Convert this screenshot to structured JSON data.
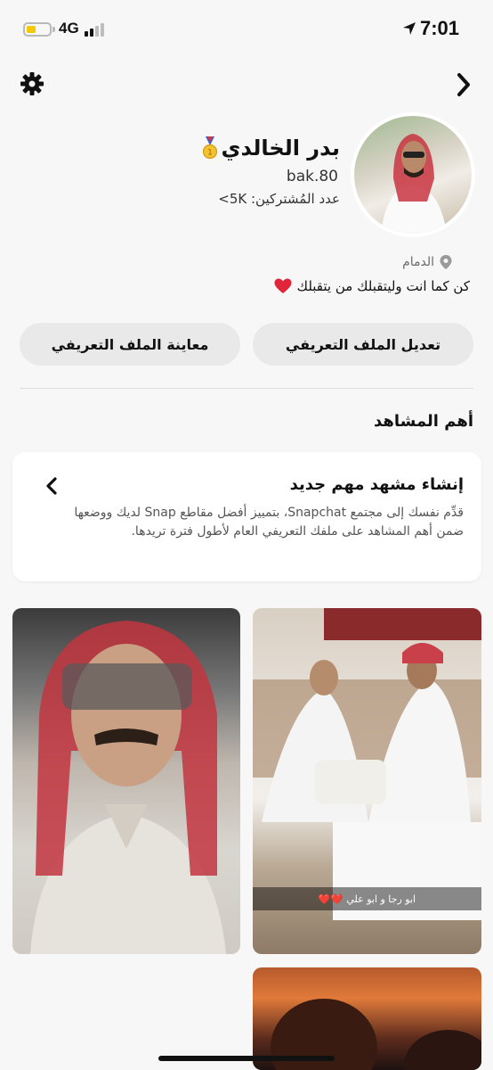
{
  "status_bar": {
    "network": "4G",
    "time": "7:01",
    "battery_level": 0.4,
    "signal_bars": 2
  },
  "icons": {
    "settings": "gear-icon",
    "back": "chevron-right-icon",
    "medal": "medal-icon",
    "location": "pin-icon",
    "bio_emoji": "red-heart-icon",
    "card_arrow": "chevron-left-icon"
  },
  "profile": {
    "display_name": "بدر الخالدي",
    "username": "bak.80",
    "subscribers": "عدد المُشتركين: 5K>",
    "location": "الدمام",
    "bio": "كن كما انت وليتقبلك من يتقبلك"
  },
  "actions": {
    "edit_label": "تعديل الملف التعريفي",
    "preview_label": "معاينة الملف التعريفي"
  },
  "highlights": {
    "title": "أهم المشاهد",
    "card_title": "إنشاء مشهد مهم جديد",
    "card_body": "قدِّم نفسك إلى مجتمع Snapchat، بتمييز أفضل مقاطع Snap لديك ووضعها ضمن أهم المشاهد على ملفك التعريفي العام لأطول فترة تريدها."
  },
  "tiles": {
    "right_top_caption": "ابو رجا و ابو علي",
    "right_top_hearts": "❤️❤️"
  },
  "colors": {
    "background": "#f7f7f7",
    "button_bg": "#e9e9ea",
    "battery": "#f4c900",
    "heart": "#e0243a"
  }
}
